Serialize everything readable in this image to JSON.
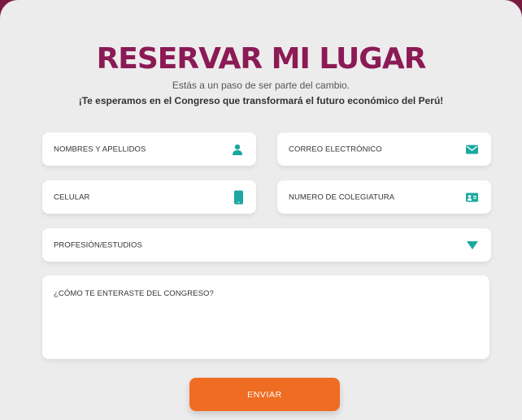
{
  "form": {
    "title": "RESERVAR MI LUGAR",
    "subtitle": "Estás a un paso de ser parte del cambio.",
    "tagline": "¡Te esperamos en el Congreso que transformará el futuro económico del Perú!",
    "fields": {
      "name": {
        "placeholder": "NOMBRES Y APELLIDOS",
        "icon": "user-icon"
      },
      "email": {
        "placeholder": "CORREO ELECTRÓNICO",
        "icon": "envelope-icon"
      },
      "phone": {
        "placeholder": "CELULAR",
        "icon": "mobile-phone-icon"
      },
      "college_number": {
        "placeholder": "NUMERO DE COLEGIATURA",
        "icon": "id-card-icon"
      },
      "profession": {
        "placeholder": "PROFESIÓN/ESTUDIOS",
        "icon": "caret-down-icon"
      },
      "how_heard": {
        "placeholder": "¿CÓMO TE ENTERASTE DEL CONGRESO?"
      }
    },
    "submit_label": "ENVIAR"
  },
  "colors": {
    "title": "#8b1a55",
    "icon_accent": "#1aa8a0",
    "button": "#ef6d22",
    "background": "#edeced"
  }
}
